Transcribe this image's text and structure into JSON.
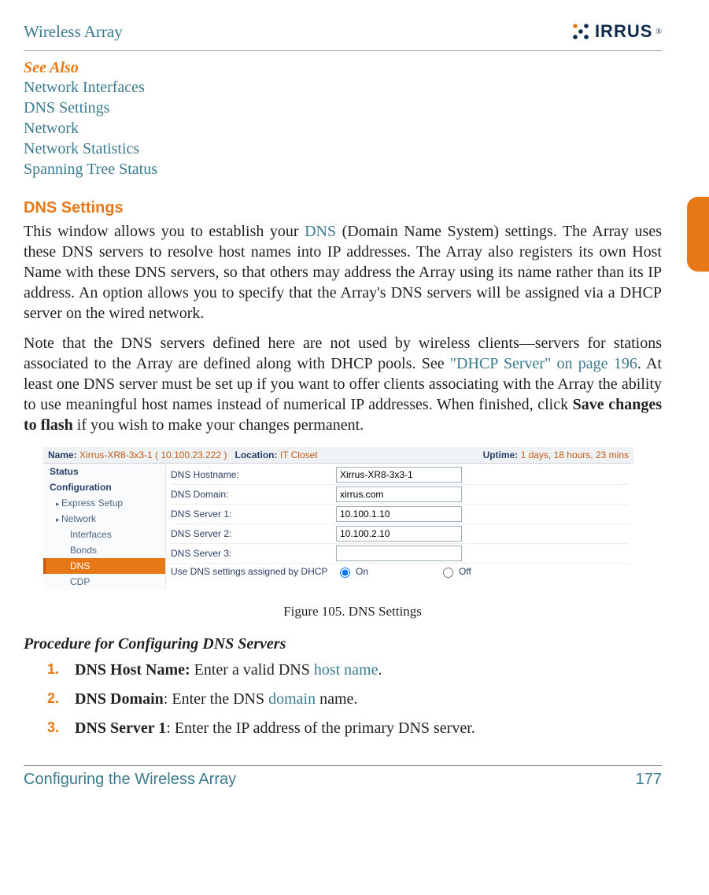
{
  "header": {
    "page_title": "Wireless Array",
    "brand_text": "IRRUS"
  },
  "see_also": {
    "heading": "See Also",
    "links": [
      "Network Interfaces",
      "DNS Settings",
      "Network",
      "Network Statistics",
      "Spanning Tree Status"
    ]
  },
  "section": {
    "heading": "DNS Settings",
    "para1_before": "This window allows you to establish your ",
    "para1_link": "DNS",
    "para1_after": " (Domain Name System) settings. The Array uses these DNS servers to resolve host names into IP addresses. The Array also registers its own Host Name with these DNS servers, so that others may address the Array using its name rather than its IP address. An option allows you to specify that the Array's DNS servers will be assigned via a DHCP server on the wired network.",
    "para2_before": "Note that the DNS servers defined here are not used by wireless clients—servers for stations associated to the Array are defined along with DHCP pools. See ",
    "para2_link": "\"DHCP Server\" on page 196",
    "para2_mid": ". At least one DNS server must be set up if you want to offer clients associating with the Array the ability to use meaningful host names instead of numerical IP addresses. When finished, click ",
    "para2_bold": "Save changes to flash",
    "para2_after": " if you wish to make your changes permanent."
  },
  "figure": {
    "banner": {
      "name_label": "Name:",
      "name_value": "Xirrus-XR8-3x3-1   ( 10.100.23.222 )",
      "location_label": "Location:",
      "location_value": "IT Closet",
      "uptime_label": "Uptime:",
      "uptime_value": "1 days, 18 hours, 23 mins"
    },
    "nav": {
      "status": "Status",
      "configuration": "Configuration",
      "express": "Express Setup",
      "network": "Network",
      "interfaces": "Interfaces",
      "bonds": "Bonds",
      "dns": "DNS",
      "cdp": "CDP"
    },
    "form": {
      "hostname_label": "DNS Hostname:",
      "hostname_value": "Xirrus-XR8-3x3-1",
      "domain_label": "DNS Domain:",
      "domain_value": "xirrus.com",
      "server1_label": "DNS Server 1:",
      "server1_value": "10.100.1.10",
      "server2_label": "DNS Server 2:",
      "server2_value": "10.100.2.10",
      "server3_label": "DNS Server 3:",
      "server3_value": "",
      "dhcp_label": "Use DNS settings assigned by DHCP",
      "on": "On",
      "off": "Off"
    },
    "caption": "Figure 105. DNS Settings"
  },
  "procedure": {
    "heading": "Procedure for Configuring DNS Servers",
    "steps": [
      {
        "bold": "DNS Host Name:",
        "pre": " Enter a valid DNS ",
        "link": "host name",
        "post": "."
      },
      {
        "bold": "DNS Domain",
        "pre": ": Enter the DNS ",
        "link": "domain",
        "post": " name."
      },
      {
        "bold": "DNS Server 1",
        "pre": ": Enter the IP address of the primary DNS server.",
        "link": "",
        "post": ""
      }
    ]
  },
  "footer": {
    "section": "Configuring the Wireless Array",
    "page_num": "177"
  }
}
